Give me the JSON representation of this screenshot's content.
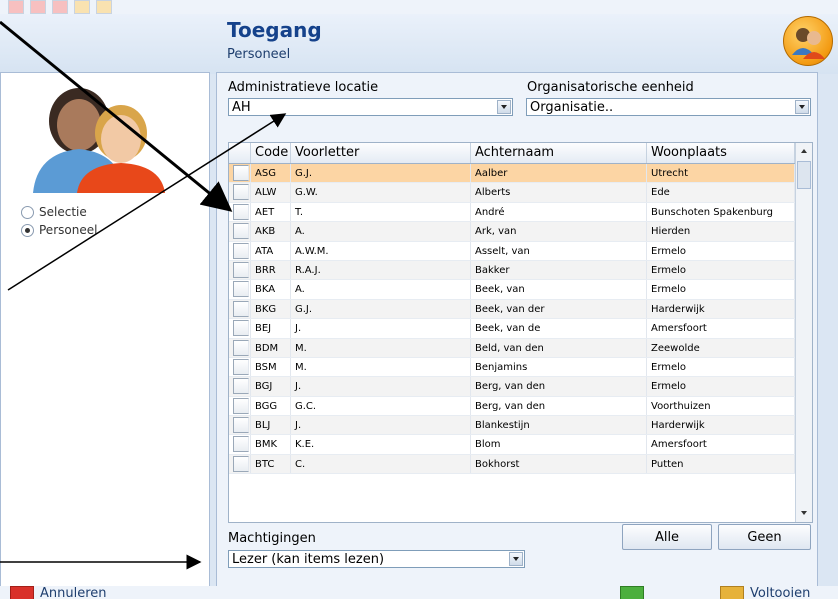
{
  "header": {
    "title": "Toegang",
    "subtitle": "Personeel"
  },
  "left_panel": {
    "options": [
      {
        "label": "Selectie",
        "selected": false
      },
      {
        "label": "Personeel",
        "selected": true
      }
    ]
  },
  "filters": {
    "admin_label": "Administratieve locatie",
    "admin_value": "AH",
    "org_label": "Organisatorische eenheid",
    "org_value": "Organisatie.."
  },
  "table": {
    "columns": [
      "Code",
      "Voorletter",
      "Achternaam",
      "Woonplaats"
    ],
    "rows": [
      [
        "ASG",
        "G.J.",
        "Aalber",
        "Utrecht"
      ],
      [
        "ALW",
        "G.W.",
        "Alberts",
        "Ede"
      ],
      [
        "AET",
        "T.",
        "André",
        "Bunschoten Spakenburg"
      ],
      [
        "AKB",
        "A.",
        "Ark, van",
        "Hierden"
      ],
      [
        "ATA",
        "A.W.M.",
        "Asselt, van",
        "Ermelo"
      ],
      [
        "BRR",
        "R.A.J.",
        "Bakker",
        "Ermelo"
      ],
      [
        "BKA",
        "A.",
        "Beek, van",
        "Ermelo"
      ],
      [
        "BKG",
        "G.J.",
        "Beek, van der",
        "Harderwijk"
      ],
      [
        "BEJ",
        "J.",
        "Beek, van de",
        "Amersfoort"
      ],
      [
        "BDM",
        "M.",
        "Beld, van den",
        "Zeewolde"
      ],
      [
        "BSM",
        "M.",
        "Benjamins",
        "Ermelo"
      ],
      [
        "BGJ",
        "J.",
        "Berg, van den",
        "Ermelo"
      ],
      [
        "BGG",
        "G.C.",
        "Berg, van den",
        "Voorthuizen"
      ],
      [
        "BLJ",
        "J.",
        "Blankestijn",
        "Harderwijk"
      ],
      [
        "BMK",
        "K.E.",
        "Blom",
        "Amersfoort"
      ],
      [
        "BTC",
        "C.",
        "Bokhorst",
        "Putten"
      ]
    ]
  },
  "permissions": {
    "label": "Machtigingen",
    "value": "Lezer (kan items lezen)",
    "all_button": "Alle",
    "none_button": "Geen"
  },
  "footer": {
    "cancel_label": "Annuleren",
    "finish_label": "Voltooien"
  },
  "colors": {
    "accent": "#15428b",
    "selected_row": "#fcd5a4",
    "panel": "#dbe6f3"
  }
}
